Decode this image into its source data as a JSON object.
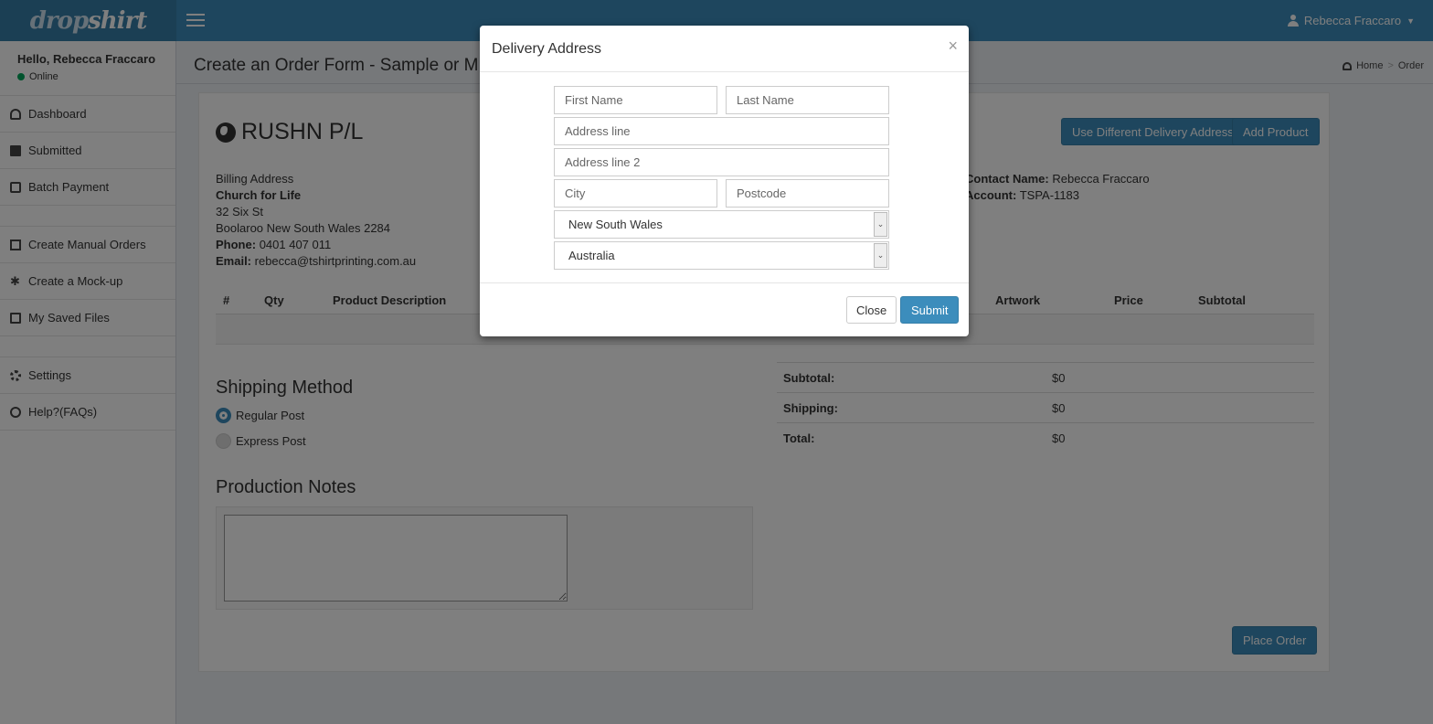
{
  "brand": {
    "logo_text_a": "drop",
    "logo_text_b": "shirt"
  },
  "header": {
    "user_name": "Rebecca Fraccaro"
  },
  "sidebar": {
    "greeting": "Hello, Rebecca Fraccaro",
    "status": "Online",
    "items": [
      {
        "label": "Dashboard",
        "icon": "dashboard-icon"
      },
      {
        "label": "Submitted",
        "icon": "folder-icon"
      },
      {
        "label": "Batch Payment",
        "icon": "money-icon"
      },
      {
        "label": "Create Manual Orders",
        "icon": "edit-icon"
      },
      {
        "label": "Create a Mock-up",
        "icon": "asterisk-icon"
      },
      {
        "label": "My Saved Files",
        "icon": "save-icon"
      },
      {
        "label": "Settings",
        "icon": "gear-icon"
      },
      {
        "label": "Help?(FAQs)",
        "icon": "lifebuoy-icon"
      }
    ]
  },
  "page": {
    "title": "Create an Order Form - Sample or M",
    "breadcrumb": {
      "home": "Home",
      "current": "Order"
    },
    "company": "RUSHN P/L",
    "buttons": {
      "different_address": "Use Different Delivery Address",
      "add_product": "Add Product",
      "place_order": "Place Order"
    },
    "billing": {
      "heading": "Billing Address",
      "name": "Church for Life",
      "street": "32 Six St",
      "city_line": "Boolaroo New South Wales 2284",
      "phone_label": "Phone:",
      "phone": "0401 407 011",
      "email_label": "Email:",
      "email": "rebecca@tshirtprinting.com.au"
    },
    "contact": {
      "name_label": "Contact Name:",
      "name": "Rebecca Fraccaro",
      "account_label": "Account:",
      "account": "TSPA-1183"
    },
    "table_headers": {
      "num": "#",
      "qty": "Qty",
      "desc": "Product Description",
      "artwork": "Artwork",
      "price": "Price",
      "subtotal": "Subtotal"
    },
    "shipping": {
      "title": "Shipping Method",
      "options": [
        "Regular Post",
        "Express Post"
      ],
      "selected": "Regular Post"
    },
    "totals": [
      {
        "label": "Subtotal:",
        "value": "$0"
      },
      {
        "label": "Shipping:",
        "value": "$0"
      },
      {
        "label": "Total:",
        "value": "$0"
      }
    ],
    "notes_title": "Production Notes"
  },
  "modal": {
    "title": "Delivery Address",
    "close_x": "×",
    "placeholders": {
      "first_name": "First Name",
      "last_name": "Last Name",
      "address1": "Address line",
      "address2": "Address line 2",
      "city": "City",
      "postcode": "Postcode"
    },
    "state": "New South Wales",
    "country": "Australia",
    "close_label": "Close",
    "submit_label": "Submit"
  }
}
